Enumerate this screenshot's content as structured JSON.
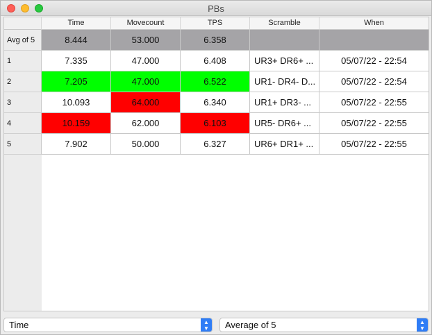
{
  "window": {
    "title": "PBs"
  },
  "table": {
    "columns": [
      "Time",
      "Movecount",
      "TPS",
      "Scramble",
      "When"
    ],
    "rows": [
      {
        "label": "Avg of 5",
        "time": "8.444",
        "movecount": "53.000",
        "tps": "6.358",
        "scramble": "",
        "when": ""
      },
      {
        "label": "1",
        "time": "7.335",
        "movecount": "47.000",
        "tps": "6.408",
        "scramble": "UR3+ DR6+ ...",
        "when": "05/07/22 - 22:54"
      },
      {
        "label": "2",
        "time": "7.205",
        "movecount": "47.000",
        "tps": "6.522",
        "scramble": "UR1- DR4- D...",
        "when": "05/07/22 - 22:54"
      },
      {
        "label": "3",
        "time": "10.093",
        "movecount": "64.000",
        "tps": "6.340",
        "scramble": "UR1+ DR3- ...",
        "when": "05/07/22 - 22:55"
      },
      {
        "label": "4",
        "time": "10.159",
        "movecount": "62.000",
        "tps": "6.103",
        "scramble": "UR5- DR6+ ...",
        "when": "05/07/22 - 22:55"
      },
      {
        "label": "5",
        "time": "7.902",
        "movecount": "50.000",
        "tps": "6.327",
        "scramble": "UR6+ DR1+ ...",
        "when": "05/07/22 - 22:55"
      }
    ]
  },
  "colors": {
    "best": "#00ff00",
    "worst": "#ff0000",
    "average_row": "#a5a4a7"
  },
  "controls": {
    "sort_select": {
      "value": "Time"
    },
    "mode_select": {
      "value": "Average of 5"
    }
  }
}
